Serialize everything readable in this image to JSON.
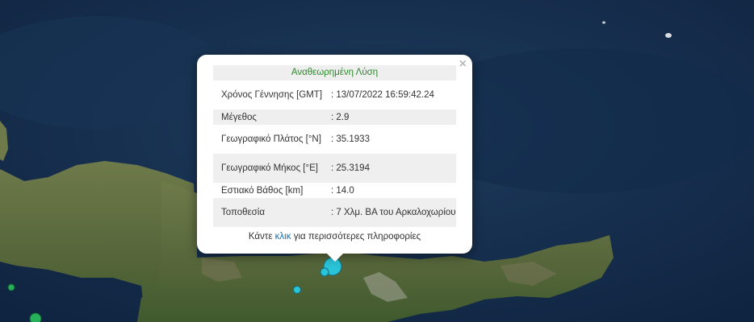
{
  "popup": {
    "title": "Αναθεωρημένη Λύση",
    "close_symbol": "×",
    "rows": [
      {
        "label": "Χρόνος Γέννησης [GMT]",
        "value": ": 13/07/2022 16:59:42.24"
      },
      {
        "label": "Μέγεθος",
        "value": ": 2.9"
      },
      {
        "label": "Γεωγραφικό Πλάτος [°N]",
        "value": ": 35.1933"
      },
      {
        "label": "Γεωγραφικό Μήκος [°E]",
        "value": ": 25.3194"
      },
      {
        "label": "Εστιακό Βάθος [km]",
        "value": ": 14.0"
      },
      {
        "label": "Τοποθεσία",
        "value": ": 7 Χλμ. ΒΑ του Αρκαλοχωρίου"
      }
    ],
    "footer_prefix": "Κάντε",
    "footer_link": "κλικ",
    "footer_suffix": "για περισσότερες πληροφορίες"
  },
  "colors": {
    "sea": "#16304f",
    "land": "#5a6a3e",
    "marker_cyan": "#2ac4d8",
    "marker_green": "#27b05a",
    "title_green": "#2a8a2a",
    "link_blue": "#1a6fb0"
  }
}
